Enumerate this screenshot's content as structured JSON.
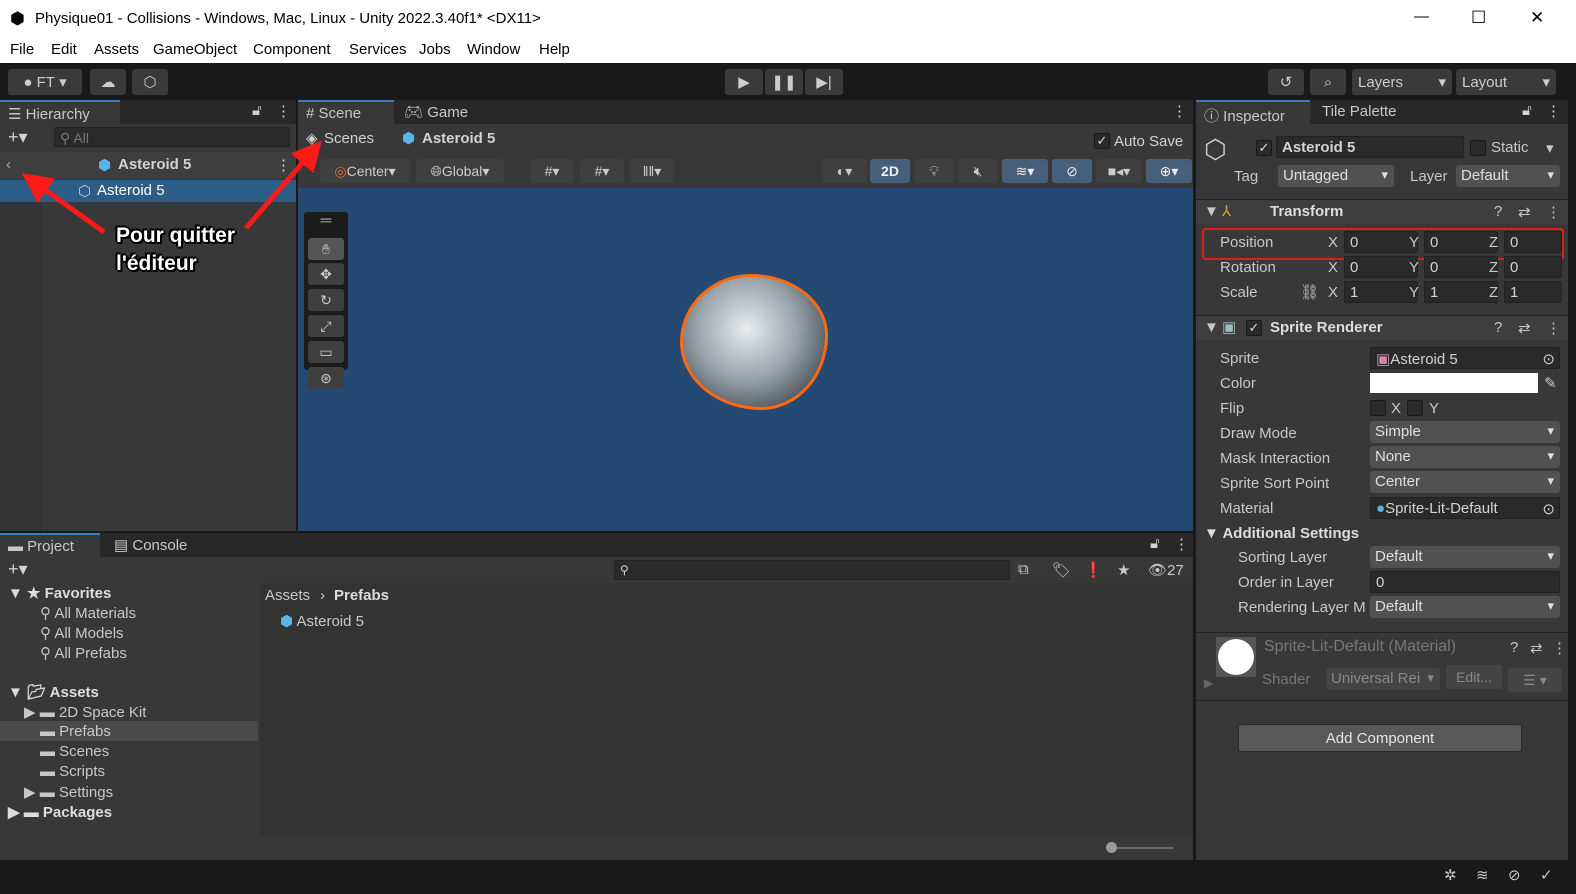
{
  "window": {
    "title": "Physique01 - Collisions - Windows, Mac, Linux - Unity 2022.3.40f1* <DX11>",
    "minimize": "—",
    "maximize": "☐",
    "close": "✕"
  },
  "menu": [
    "File",
    "Edit",
    "Assets",
    "GameObject",
    "Component",
    "Services",
    "Jobs",
    "Window",
    "Help"
  ],
  "toolbar": {
    "account": "FT",
    "layers": "Layers",
    "layout": "Layout"
  },
  "hierarchy": {
    "tab": "Hierarchy",
    "search_placeholder": "All",
    "scene_title": "Asteroid 5",
    "items": [
      "Asteroid 5"
    ]
  },
  "scene": {
    "tabs": [
      "Scene",
      "Game"
    ],
    "breadcrumb": [
      "Scenes",
      "Asteroid 5"
    ],
    "auto_save": "Auto Save",
    "pivot": "Center",
    "space": "Global",
    "mode_2d": "2D"
  },
  "annotation": {
    "text_line1": "Pour quitter",
    "text_line2": "l'éditeur",
    "color": "#ff1a1a"
  },
  "inspector": {
    "tabs": [
      "Inspector",
      "Tile Palette"
    ],
    "object_name": "Asteroid 5",
    "static": "Static",
    "tag_label": "Tag",
    "tag": "Untagged",
    "layer_label": "Layer",
    "layer": "Default",
    "transform": {
      "title": "Transform",
      "rows": [
        {
          "label": "Position",
          "x": "0",
          "y": "0",
          "z": "0"
        },
        {
          "label": "Rotation",
          "x": "0",
          "y": "0",
          "z": "0"
        },
        {
          "label": "Scale",
          "x": "1",
          "y": "1",
          "z": "1"
        }
      ]
    },
    "sprite_renderer": {
      "title": "Sprite Renderer",
      "sprite_label": "Sprite",
      "sprite": "Asteroid 5",
      "color_label": "Color",
      "flip_label": "Flip",
      "flip_x": "X",
      "flip_y": "Y",
      "draw_mode_label": "Draw Mode",
      "draw_mode": "Simple",
      "mask_label": "Mask Interaction",
      "mask": "None",
      "sort_point_label": "Sprite Sort Point",
      "sort_point": "Center",
      "material_label": "Material",
      "material": "Sprite-Lit-Default",
      "additional": "Additional Settings",
      "sorting_layer_label": "Sorting Layer",
      "sorting_layer": "Default",
      "order_label": "Order in Layer",
      "order": "0",
      "rendering_layer_label": "Rendering Layer M",
      "rendering_layer": "Default"
    },
    "material": {
      "title": "Sprite-Lit-Default (Material)",
      "shader_label": "Shader",
      "shader": "Universal Rei",
      "edit": "Edit..."
    },
    "add_component": "Add Component"
  },
  "project": {
    "tabs": [
      "Project",
      "Console"
    ],
    "count": "27",
    "favorites": "Favorites",
    "fav_items": [
      "All Materials",
      "All Models",
      "All Prefabs"
    ],
    "assets": "Assets",
    "folders": [
      "2D Space Kit",
      "Prefabs",
      "Scenes",
      "Scripts",
      "Settings"
    ],
    "packages": "Packages",
    "breadcrumb": [
      "Assets",
      "Prefabs"
    ],
    "files": [
      "Asteroid 5"
    ]
  },
  "colors": {
    "selection": "#2c5d87",
    "scene_bg": "#244a73",
    "highlight": "#e01b1b"
  }
}
